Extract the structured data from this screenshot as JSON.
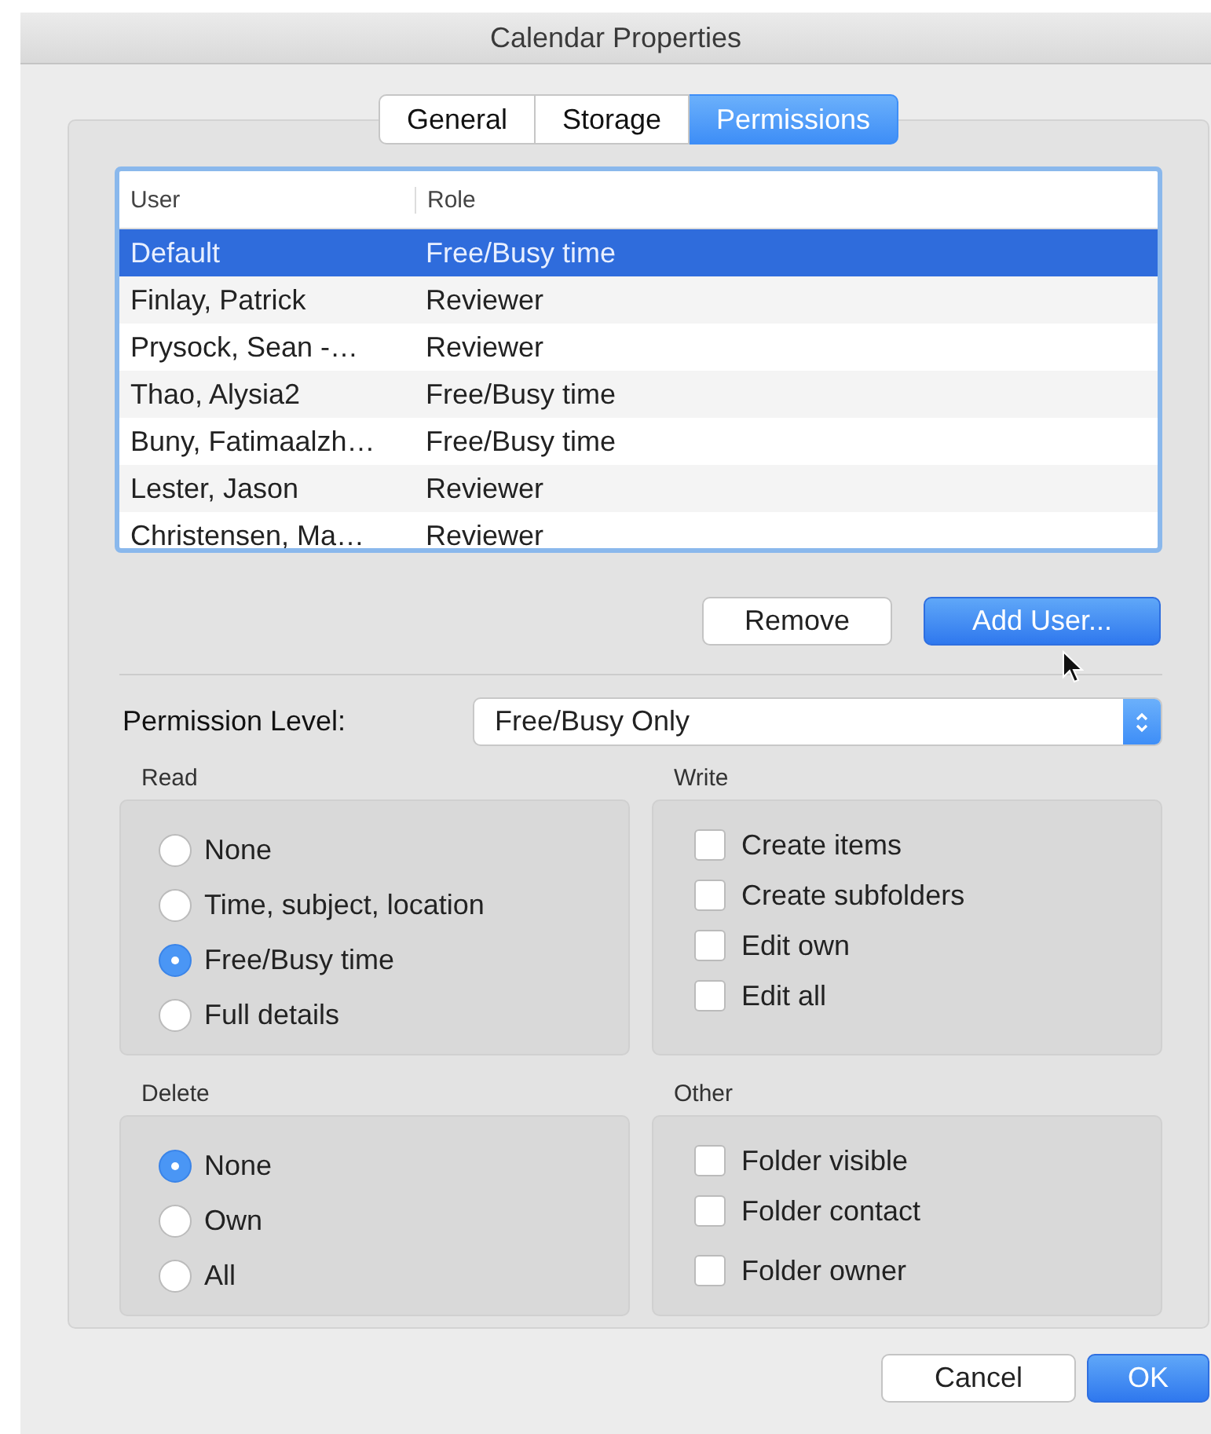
{
  "window": {
    "title": "Calendar Properties"
  },
  "tabs": [
    {
      "label": "General",
      "selected": false
    },
    {
      "label": "Storage",
      "selected": false
    },
    {
      "label": "Permissions",
      "selected": true
    }
  ],
  "table": {
    "columns": [
      "User",
      "Role"
    ],
    "rows": [
      {
        "user": "Default",
        "role": "Free/Busy time",
        "selected": true
      },
      {
        "user": "Finlay, Patrick",
        "role": "Reviewer",
        "selected": false
      },
      {
        "user": "Prysock, Sean -…",
        "role": "Reviewer",
        "selected": false
      },
      {
        "user": "Thao, Alysia2",
        "role": "Free/Busy time",
        "selected": false
      },
      {
        "user": "Buny, Fatimaalzh…",
        "role": "Free/Busy time",
        "selected": false
      },
      {
        "user": "Lester, Jason",
        "role": "Reviewer",
        "selected": false
      },
      {
        "user": "Christensen, Ma…",
        "role": "Reviewer",
        "selected": false
      }
    ]
  },
  "list_buttons": [
    {
      "label": "Remove",
      "default": false
    },
    {
      "label": "Add User...",
      "default": true
    }
  ],
  "permission_level": {
    "label": "Permission Level:",
    "value": "Free/Busy Only"
  },
  "groups": [
    {
      "title": "Read",
      "kind": "radio",
      "options": [
        {
          "label": "None",
          "selected": false
        },
        {
          "label": "Time, subject, location",
          "selected": false
        },
        {
          "label": "Free/Busy time",
          "selected": true
        },
        {
          "label": "Full details",
          "selected": false
        }
      ]
    },
    {
      "title": "Write",
      "kind": "checkbox",
      "options": [
        {
          "label": "Create items",
          "checked": false
        },
        {
          "label": "Create subfolders",
          "checked": false
        },
        {
          "label": "Edit own",
          "checked": false
        },
        {
          "label": "Edit all",
          "checked": false
        }
      ]
    },
    {
      "title": "Delete",
      "kind": "radio",
      "options": [
        {
          "label": "None",
          "selected": true
        },
        {
          "label": "Own",
          "selected": false
        },
        {
          "label": "All",
          "selected": false
        }
      ]
    },
    {
      "title": "Other",
      "kind": "checkbox",
      "options": [
        {
          "label": "Folder visible",
          "checked": false
        },
        {
          "label": "Folder contact",
          "checked": false
        },
        {
          "label": "Folder owner",
          "checked": false
        }
      ]
    }
  ],
  "dialog_buttons": [
    {
      "label": "Cancel",
      "default": false
    },
    {
      "label": "OK",
      "default": true
    }
  ]
}
